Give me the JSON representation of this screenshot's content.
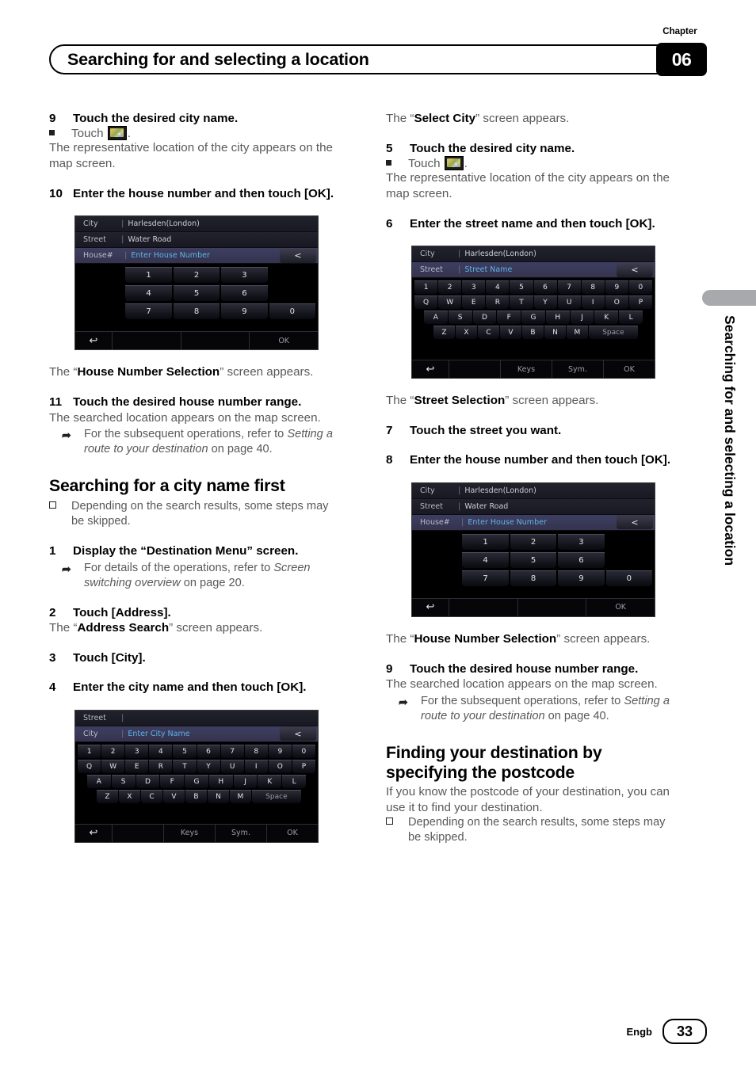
{
  "header": {
    "title": "Searching for and selecting a location",
    "chapter_label": "Chapter",
    "chapter_number": "06"
  },
  "side_tab": {
    "text": "Searching for and selecting a location"
  },
  "footer": {
    "language": "Engb",
    "page_number": "33"
  },
  "left_column": {
    "step9": {
      "num": "9",
      "text": "Touch the desired city name."
    },
    "touch_label": "Touch",
    "touch_icon": "map-icon",
    "touch_period": ".",
    "repr_location": "The representative location of the city appears on the map screen.",
    "step10": {
      "num": "10",
      "text": "Enter the house number and then touch [OK]."
    },
    "house_number_sentence_pre": "The “",
    "house_number_sentence_bold": "House Number Selection",
    "house_number_sentence_post": "” screen appears.",
    "step11": {
      "num": "11",
      "text": "Touch the desired house number range."
    },
    "searched_location": "The searched location appears on the map screen.",
    "note_subsequent_pre": "For the subsequent operations, refer to ",
    "note_subsequent_italic": "Setting a route to your destination",
    "note_subsequent_post": " on page 40.",
    "h2_city_first": "Searching for a city name first",
    "note_depending": "Depending on the search results, some steps may be skipped.",
    "step1": {
      "num": "1",
      "text": "Display the “Destination Menu” screen."
    },
    "note_details_pre": "For details of the operations, refer to ",
    "note_details_italic": "Screen switching overview",
    "note_details_post": " on page 20.",
    "step2": {
      "num": "2",
      "text": "Touch [Address]."
    },
    "address_search_pre": "The “",
    "address_search_bold": "Address Search",
    "address_search_post": "” screen appears.",
    "step3": {
      "num": "3",
      "text": "Touch [City]."
    },
    "step4": {
      "num": "4",
      "text": "Enter the city name and then touch [OK]."
    }
  },
  "right_column": {
    "select_city_pre": "The “",
    "select_city_bold": "Select City",
    "select_city_post": "” screen appears.",
    "step5": {
      "num": "5",
      "text": "Touch the desired city name."
    },
    "touch_label": "Touch",
    "touch_icon": "map-icon",
    "repr_location": "The representative location of the city appears on the map screen.",
    "step6": {
      "num": "6",
      "text": "Enter the street name and then touch [OK]."
    },
    "street_selection_pre": "The “",
    "street_selection_bold": "Street Selection",
    "street_selection_post": "” screen appears.",
    "step7": {
      "num": "7",
      "text": "Touch the street you want."
    },
    "step8": {
      "num": "8",
      "text": "Enter the house number and then touch [OK]."
    },
    "house_number_sentence_pre": "The “",
    "house_number_sentence_bold": "House Number Selection",
    "house_number_sentence_post": "” screen appears.",
    "step9": {
      "num": "9",
      "text": "Touch the desired house number range."
    },
    "searched_location": "The searched location appears on the map screen.",
    "note_subsequent_pre": "For the subsequent operations, refer to ",
    "note_subsequent_italic": "Setting a route to your destination",
    "note_subsequent_post": " on page 40.",
    "h2_postcode": "Finding your destination by specifying the postcode",
    "postcode_intro": "If you know the postcode of your destination, you can use it to find your destination.",
    "note_depending": "Depending on the search results, some steps may be skipped."
  },
  "screens": {
    "house_number": {
      "fields": [
        {
          "label": "City",
          "value": "Harlesden(London)",
          "state": "plain"
        },
        {
          "label": "Street",
          "value": "Water Road",
          "state": "plain"
        },
        {
          "label": "House#",
          "value": "Enter House Number",
          "state": "active"
        }
      ],
      "back_key": "<",
      "rows": [
        [
          "",
          "1",
          "2",
          "3",
          ""
        ],
        [
          "",
          "4",
          "5",
          "6",
          ""
        ],
        [
          "",
          "7",
          "8",
          "9",
          "0"
        ]
      ],
      "bottom": {
        "back": "↩",
        "cells": [
          "",
          "",
          ""
        ],
        "ok": "OK"
      }
    },
    "street_name": {
      "fields": [
        {
          "label": "City",
          "value": "Harlesden(London)",
          "state": "plain"
        },
        {
          "label": "Street",
          "value": "Street Name",
          "state": "active"
        }
      ],
      "back_key": "<",
      "rows": [
        [
          "1",
          "2",
          "3",
          "4",
          "5",
          "6",
          "7",
          "8",
          "9",
          "0"
        ],
        [
          "Q",
          "W",
          "E",
          "R",
          "T",
          "Y",
          "U",
          "I",
          "O",
          "P"
        ],
        [
          "A",
          "S",
          "D",
          "F",
          "G",
          "H",
          "J",
          "K",
          "L"
        ],
        [
          "Z",
          "X",
          "C",
          "V",
          "B",
          "N",
          "M",
          "Space"
        ]
      ],
      "bottom": {
        "back": "↩",
        "keys": "Keys",
        "sym": "Sym.",
        "ok": "OK"
      }
    },
    "city_name": {
      "fields": [
        {
          "label": "Street",
          "value": "",
          "state": "plain"
        },
        {
          "label": "City",
          "value": "Enter City Name",
          "state": "active"
        }
      ],
      "back_key": "<",
      "rows": [
        [
          "1",
          "2",
          "3",
          "4",
          "5",
          "6",
          "7",
          "8",
          "9",
          "0"
        ],
        [
          "Q",
          "W",
          "E",
          "R",
          "T",
          "Y",
          "U",
          "I",
          "O",
          "P"
        ],
        [
          "A",
          "S",
          "D",
          "F",
          "G",
          "H",
          "J",
          "K",
          "L"
        ],
        [
          "Z",
          "X",
          "C",
          "V",
          "B",
          "N",
          "M",
          "Space"
        ]
      ],
      "bottom": {
        "back": "↩",
        "keys": "Keys",
        "sym": "Sym.",
        "ok": "OK"
      }
    }
  }
}
